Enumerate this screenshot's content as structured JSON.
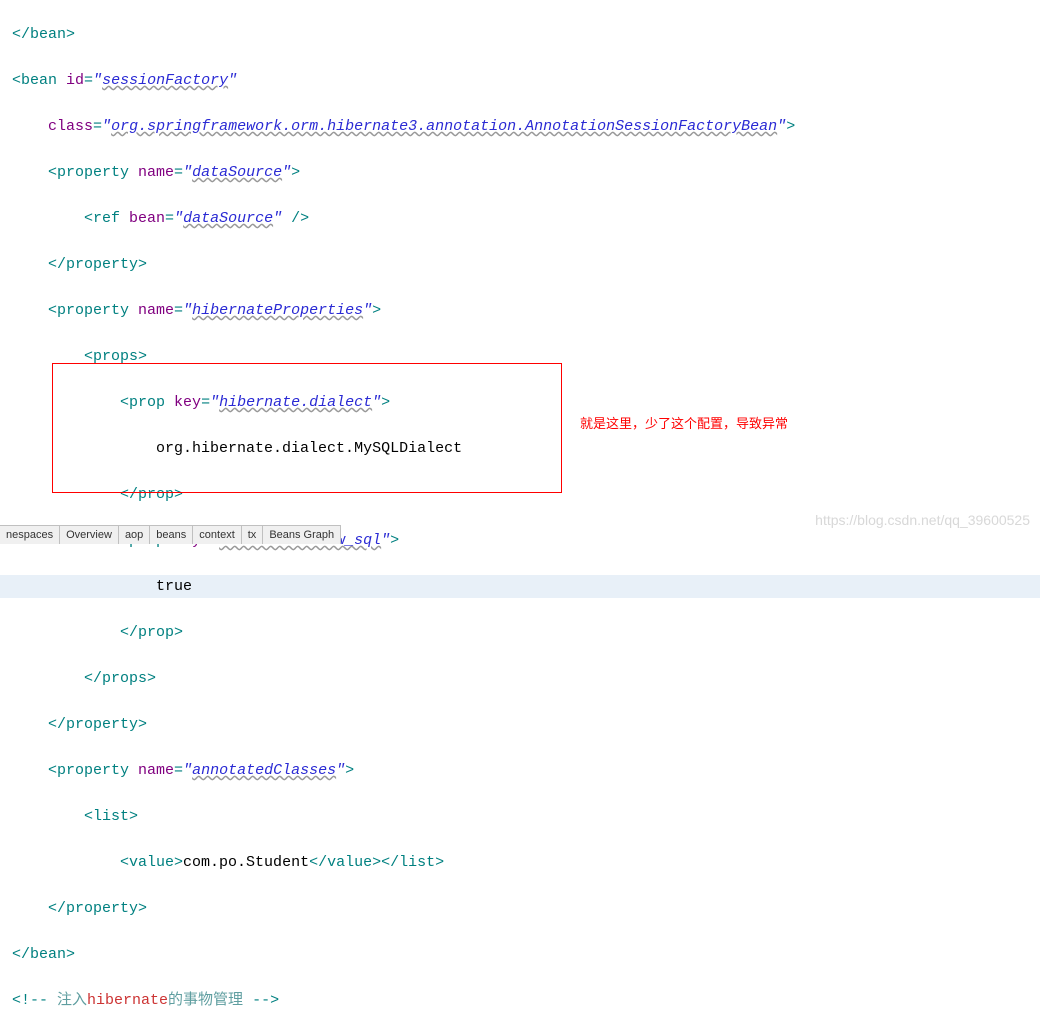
{
  "code": {
    "line1": {
      "closeBean": "</bean>"
    },
    "line2": {
      "open": "<bean ",
      "attrId": "id",
      "valId": "sessionFactory",
      "quote": "\""
    },
    "line3": {
      "attrClass": "class",
      "valClass": "org.springframework.orm.hibernate3.annotation.AnnotationSessionFactoryBean",
      "close": ">"
    },
    "line4": {
      "openProp": "<property ",
      "attrName": "name",
      "valName": "dataSource",
      "close": ">"
    },
    "line5": {
      "openRef": "<ref ",
      "attrBean": "bean",
      "valBean": "dataSource",
      "close": " />"
    },
    "line6": {
      "closeProp": "</property>"
    },
    "line7": {
      "openProp": "<property ",
      "attrName": "name",
      "valName": "hibernateProperties",
      "close": ">"
    },
    "line8": {
      "openProps": "<props>"
    },
    "line9": {
      "openProp": "<prop ",
      "attrKey": "key",
      "valKey": "hibernate.dialect",
      "close": ">"
    },
    "line10": {
      "text": "org.hibernate.dialect.MySQLDialect"
    },
    "line11": {
      "closeProp": "</prop>"
    },
    "line12": {
      "openProp": "<prop ",
      "attrKey": "key",
      "valKey": "hibernate.show_sql",
      "close": ">"
    },
    "line13": {
      "text": "true"
    },
    "line14": {
      "closeProp": "</prop>"
    },
    "line15": {
      "closeProps": "</props>"
    },
    "line16": {
      "closeProperty": "</property>"
    },
    "line17": {
      "openProp": "<property ",
      "attrName": "name",
      "valName": "annotatedClasses",
      "close": ">"
    },
    "line18": {
      "openList": "<list>"
    },
    "line19": {
      "openValue": "<value>",
      "text": "com.po.Student",
      "closeValue": "</value>",
      "closeList": "</list>"
    },
    "line20": {
      "closeProperty": "</property>"
    },
    "line21": {
      "closeBean": "</bean>"
    },
    "line22": {
      "commentOpen": "<!-- ",
      "commentPre": "注入",
      "hibernate": "hibernate",
      "commentPost": "的事物管理",
      "commentClose": " -->"
    }
  },
  "annotation": "就是这里，少了这个配置，导致异常",
  "tabs": {
    "t1": "nespaces",
    "t2": "Overview",
    "t3": "aop",
    "t4": "beans",
    "t5": "context",
    "t6": "tx",
    "t7": "Beans Graph"
  },
  "watermark": "https://blog.csdn.net/qq_39600525"
}
